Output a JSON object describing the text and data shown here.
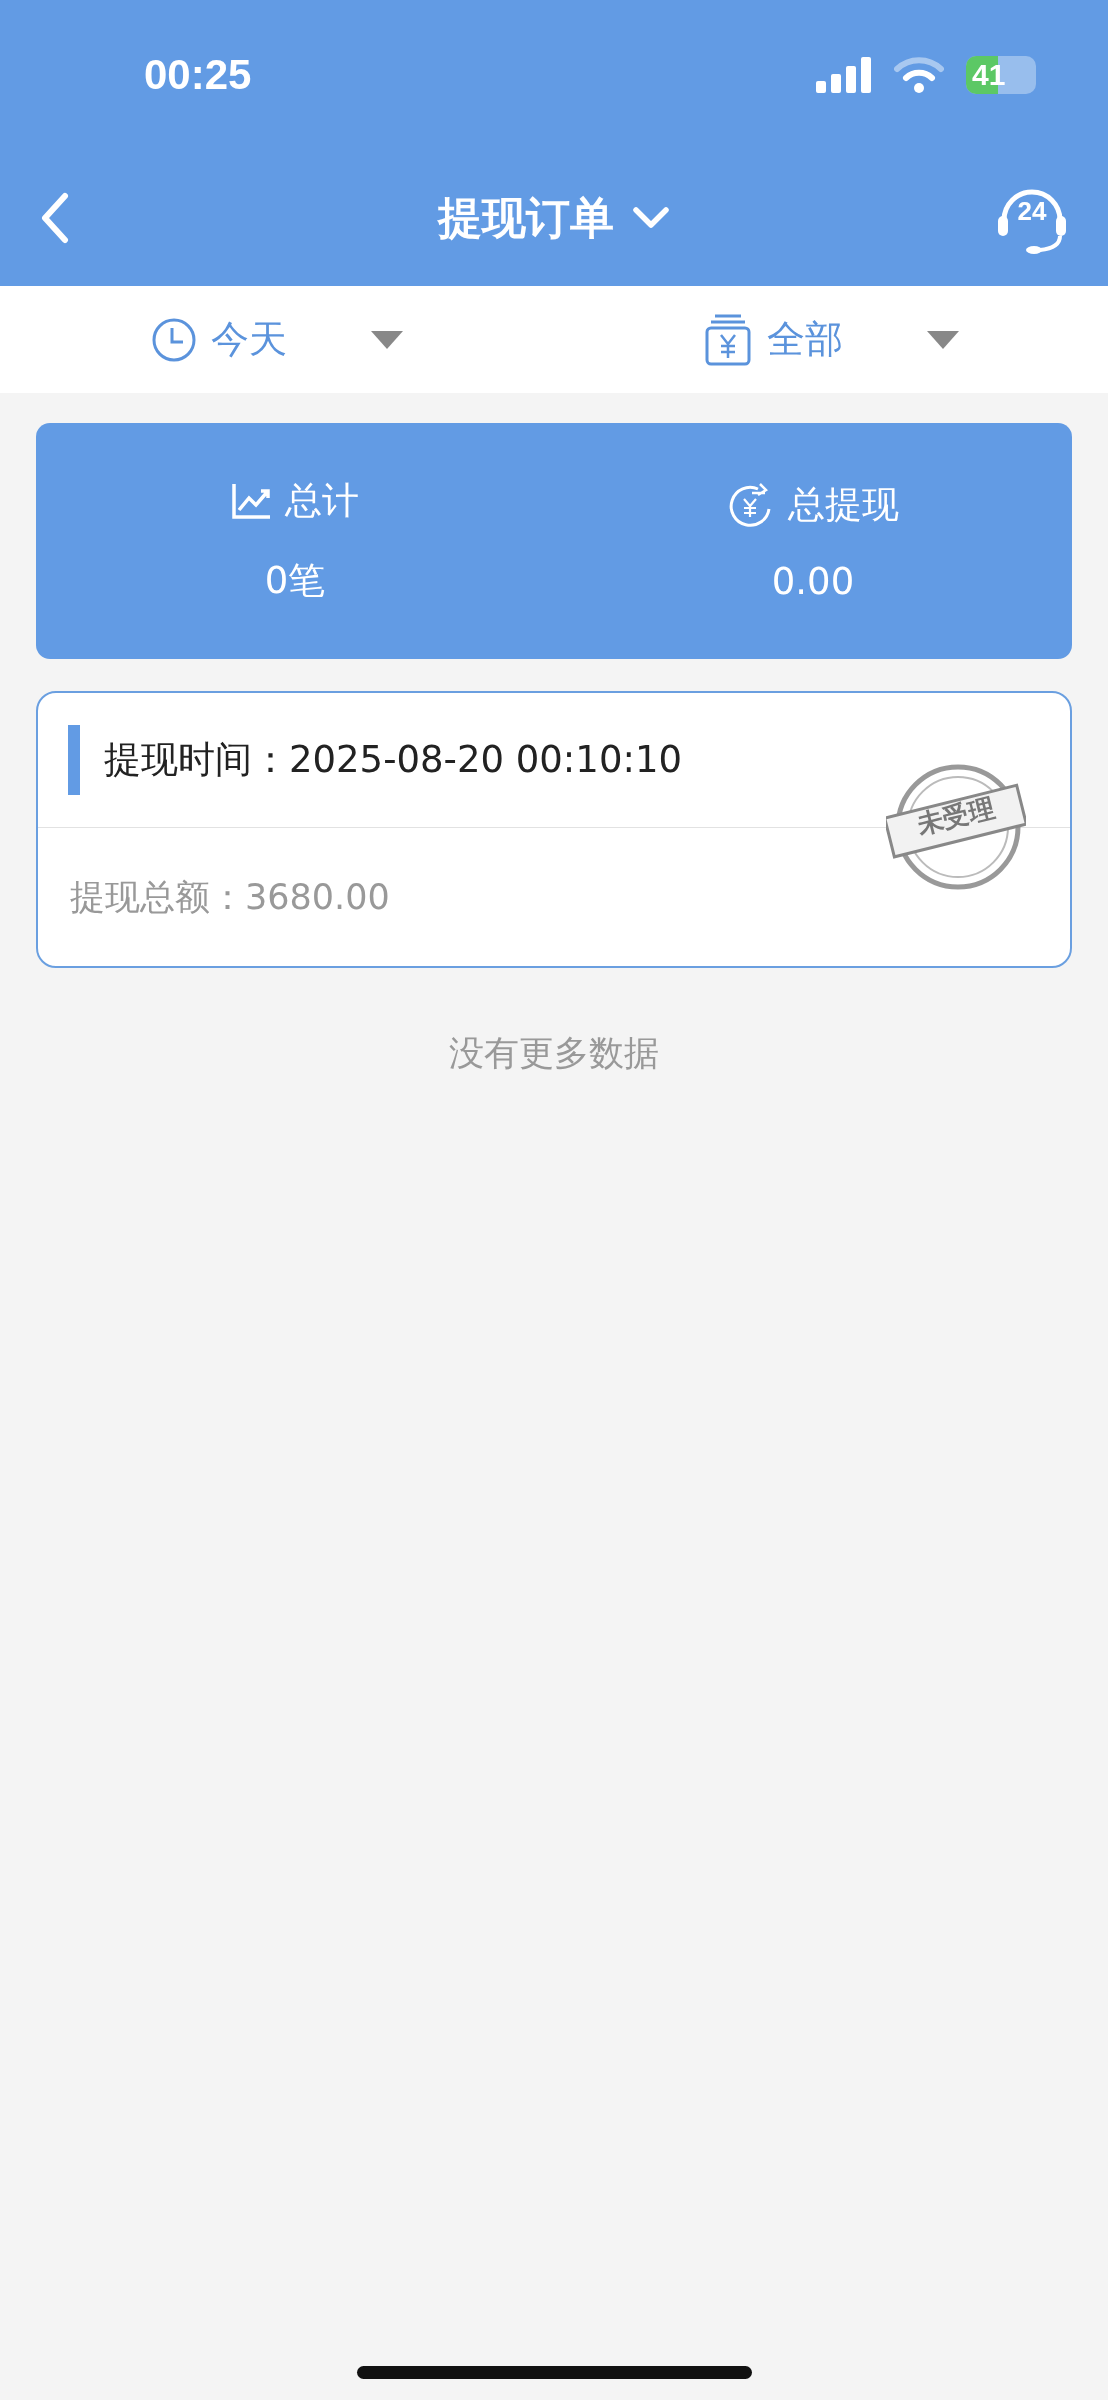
{
  "status_bar": {
    "time": "00:25",
    "battery": "41"
  },
  "nav": {
    "title": "提现订单",
    "support_badge": "24"
  },
  "filters": [
    {
      "kind": "clock",
      "label": "今天"
    },
    {
      "kind": "wallet",
      "label": "全部"
    }
  ],
  "summary": [
    {
      "kind": "chart",
      "label": "总计",
      "value": "0笔"
    },
    {
      "kind": "exchange",
      "label": "总提现",
      "value": "0.00"
    }
  ],
  "orders": [
    {
      "time": "提现时间：2025-08-20 00:10:10",
      "amount": "提现总额：3680.00",
      "stamp": "未受理"
    }
  ],
  "footer": "没有更多数据"
}
